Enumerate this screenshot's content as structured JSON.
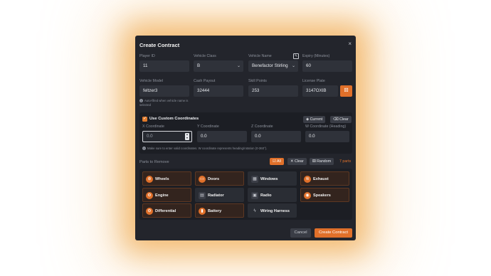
{
  "modal": {
    "title": "Create Contract",
    "close_icon": "×"
  },
  "fields": {
    "player_id": {
      "label": "Player ID",
      "value": "11"
    },
    "vehicle_class": {
      "label": "Vehicle Class",
      "value": "B"
    },
    "vehicle_name": {
      "label": "Vehicle Name",
      "value": "Benefactor Stirling"
    },
    "expiry": {
      "label": "Expiry (Minutes)",
      "value": "60"
    },
    "vehicle_model": {
      "label": "Vehicle Model",
      "value": "feltzer3",
      "hint": "Auto-filled when vehicle name is selected"
    },
    "cash_payout": {
      "label": "Cash Payout",
      "value": "32444"
    },
    "skill_points": {
      "label": "Skill Points",
      "value": "253"
    },
    "license_plate": {
      "label": "License Plate",
      "value": "3147OXIB"
    }
  },
  "coords": {
    "toggle_label": "Use Custom Coordinates",
    "current_label": "Current",
    "clear_label": "Clear",
    "x": {
      "label": "X Coordinate",
      "value": "0.0"
    },
    "y": {
      "label": "Y Coordinate",
      "value": "0.0"
    },
    "z": {
      "label": "Z Coordinate",
      "value": "0.0"
    },
    "w": {
      "label": "W Coordinate (Heading)",
      "value": "0.0"
    },
    "hint": "Make sure to enter valid coordinates. W coordinate represents heading/rotation (0-360°)."
  },
  "parts": {
    "label": "Parts to Remove",
    "all_label": "All",
    "clear_label": "Clear",
    "random_label": "Random",
    "count": "7 parts",
    "items": [
      {
        "label": "Wheels",
        "selected": true,
        "icon": "wheel-icon"
      },
      {
        "label": "Doors",
        "selected": true,
        "icon": "door-icon"
      },
      {
        "label": "Windows",
        "selected": false,
        "icon": "window-icon"
      },
      {
        "label": "Exhaust",
        "selected": true,
        "icon": "exhaust-icon"
      },
      {
        "label": "Engine",
        "selected": true,
        "icon": "engine-icon"
      },
      {
        "label": "Radiator",
        "selected": false,
        "icon": "radiator-icon"
      },
      {
        "label": "Radio",
        "selected": false,
        "icon": "radio-icon"
      },
      {
        "label": "Speakers",
        "selected": true,
        "icon": "speaker-icon"
      },
      {
        "label": "Differential",
        "selected": true,
        "icon": "differential-icon"
      },
      {
        "label": "Battery",
        "selected": true,
        "icon": "battery-icon"
      },
      {
        "label": "Wiring Harness",
        "selected": false,
        "icon": "bolt-icon"
      }
    ]
  },
  "footer": {
    "cancel_label": "Cancel",
    "create_label": "Create Contract"
  },
  "colors": {
    "accent": "#e0702a",
    "modal_bg": "#23252c",
    "field_bg": "#2f323a"
  }
}
